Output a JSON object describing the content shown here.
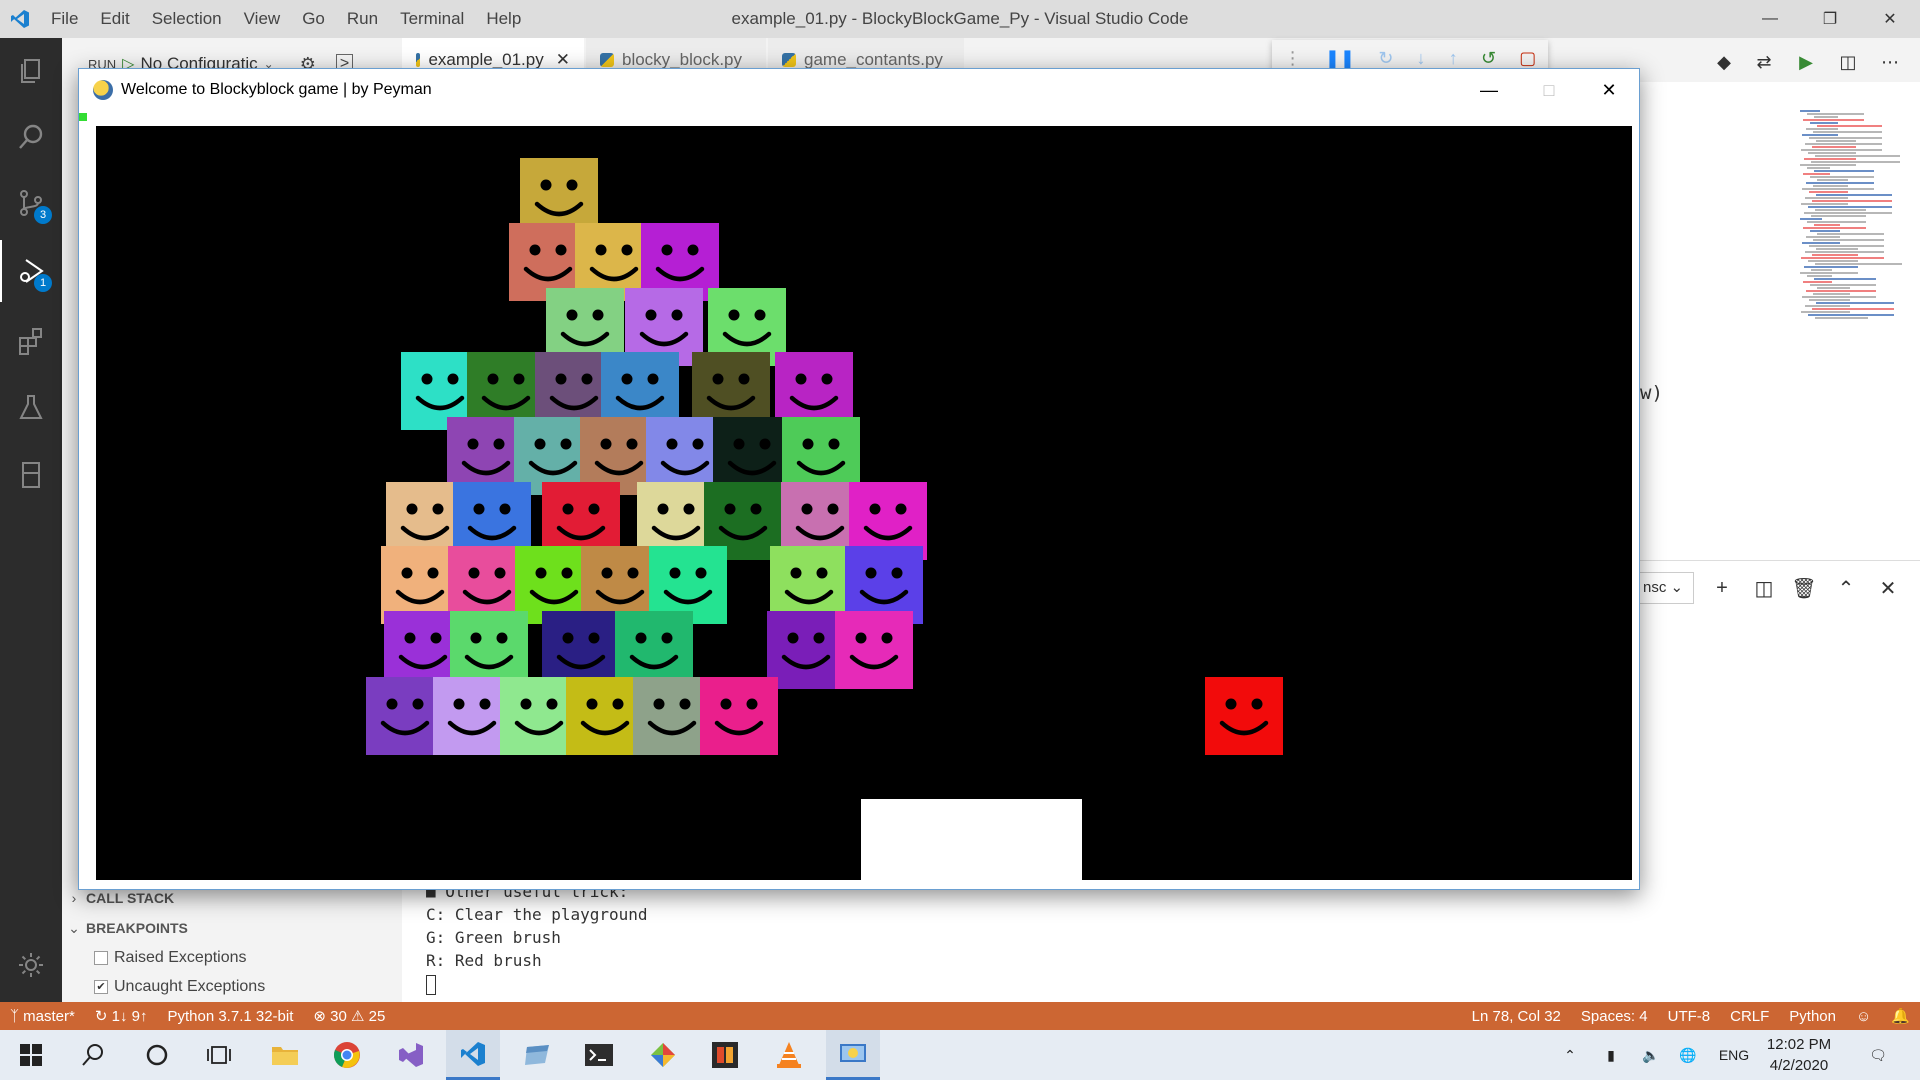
{
  "vscode": {
    "menu": [
      "File",
      "Edit",
      "Selection",
      "View",
      "Go",
      "Run",
      "Terminal",
      "Help"
    ],
    "window_title": "example_01.py - BlockyBlockGame_Py - Visual Studio Code",
    "run_label": "RUN",
    "config_select": "No Configuratic",
    "tabs": [
      {
        "label": "example_01.py",
        "active": true
      },
      {
        "label": "blocky_block.py",
        "active": false
      },
      {
        "label": "game_contants.py",
        "active": false
      }
    ],
    "activity_badges": {
      "source_control": "3",
      "debug": "1"
    },
    "sidebar": {
      "call_stack": "CALL STACK",
      "breakpoints": "BREAKPOINTS",
      "breakpoint_items": [
        {
          "label": "Raised Exceptions",
          "checked": false
        },
        {
          "label": "Uncaught Exceptions",
          "checked": true
        }
      ]
    },
    "editor_fragment": "w)",
    "terminal_select": "nsc",
    "terminal_lines": [
      "■ Other useful trick:",
      "C: Clear the playground",
      "G: Green brush",
      "R: Red brush"
    ],
    "statusbar": {
      "branch": "master*",
      "sync": "1↓ 9↑",
      "interpreter": "Python 3.7.1 32-bit",
      "errors": "30",
      "warnings": "25",
      "position": "Ln 78, Col 32",
      "spaces": "Spaces: 4",
      "encoding": "UTF-8",
      "eol": "CRLF",
      "language": "Python"
    },
    "accent_color": "#cc6633"
  },
  "game": {
    "window_title": "Welcome to Blockyblock game | by Peyman",
    "canvas_background": "#000000",
    "blocks": [
      {
        "color": "#c6a83a"
      },
      {
        "color": "#cf6e5c"
      },
      {
        "color": "#dcb64a"
      },
      {
        "color": "#b51fd4"
      },
      {
        "color": "#83d183"
      },
      {
        "color": "#b66ae6"
      },
      {
        "color": "#6cde6c"
      },
      {
        "color": "#2de0c6"
      },
      {
        "color": "#2f7d27"
      },
      {
        "color": "#6c4f7a"
      },
      {
        "color": "#3b87c8"
      },
      {
        "color": "#4f4f23"
      },
      {
        "color": "#b824c4"
      },
      {
        "color": "#8e45b3"
      },
      {
        "color": "#64b0a8"
      },
      {
        "color": "#b37c5b"
      },
      {
        "color": "#8288e8"
      },
      {
        "color": "#0d2018"
      },
      {
        "color": "#4ecb58"
      },
      {
        "color": "#e5bc8c"
      },
      {
        "color": "#3a74e0"
      },
      {
        "color": "#e21c35"
      },
      {
        "color": "#ddd89a"
      },
      {
        "color": "#1c6e22"
      },
      {
        "color": "#c870b0"
      },
      {
        "color": "#e021c6"
      },
      {
        "color": "#f0b17c"
      },
      {
        "color": "#e84d9c"
      },
      {
        "color": "#6ee01c"
      },
      {
        "color": "#bf8a46"
      },
      {
        "color": "#24e391"
      },
      {
        "color": "#8ee05e"
      },
      {
        "color": "#5b40e8"
      },
      {
        "color": "#9a30d8"
      },
      {
        "color": "#5bd96c"
      },
      {
        "color": "#2a1f84"
      },
      {
        "color": "#21b86e"
      },
      {
        "color": "#7a1eb8"
      },
      {
        "color": "#e62ab8"
      },
      {
        "color": "#7a3dc0"
      },
      {
        "color": "#c29af0"
      },
      {
        "color": "#8fe88f"
      },
      {
        "color": "#c4bc16"
      },
      {
        "color": "#8ea28a"
      },
      {
        "color": "#ea1f8c"
      },
      {
        "color": "#f20b0b"
      }
    ]
  },
  "taskbar": {
    "language": "ENG",
    "time": "12:02 PM",
    "date": "4/2/2020"
  }
}
